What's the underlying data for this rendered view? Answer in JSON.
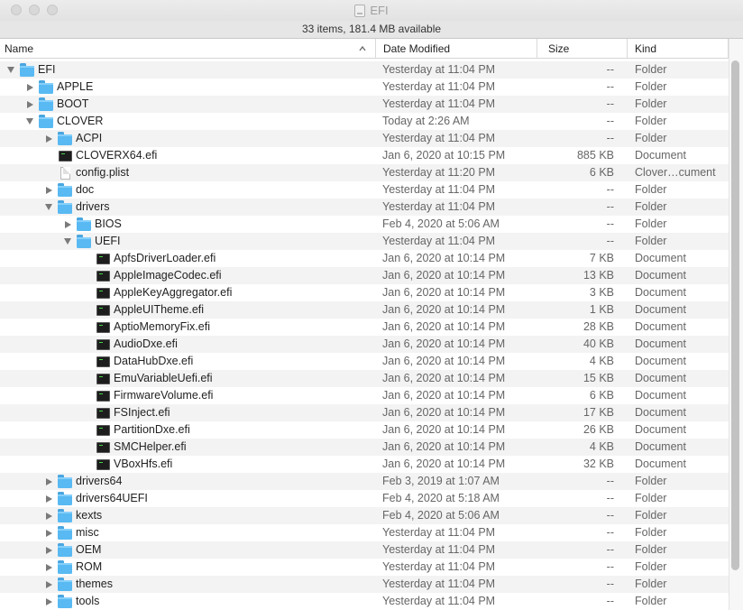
{
  "window": {
    "title": "EFI",
    "status": "33 items, 181.4 MB available"
  },
  "columns": {
    "name": "Name",
    "date": "Date Modified",
    "size": "Size",
    "kind": "Kind"
  },
  "icons": {
    "folder": "folder-icon",
    "executable": "executable-file-icon",
    "document": "document-file-icon"
  },
  "colors": {
    "folder": "#59b9f2",
    "row_alt": "#f3f3f3"
  },
  "rows": [
    {
      "name": "EFI",
      "date": "Yesterday at 11:04 PM",
      "size": "--",
      "kind": "Folder",
      "icon": "folder",
      "depth": 0,
      "expanded": true
    },
    {
      "name": "APPLE",
      "date": "Yesterday at 11:04 PM",
      "size": "--",
      "kind": "Folder",
      "icon": "folder",
      "depth": 1,
      "expanded": false
    },
    {
      "name": "BOOT",
      "date": "Yesterday at 11:04 PM",
      "size": "--",
      "kind": "Folder",
      "icon": "folder",
      "depth": 1,
      "expanded": false
    },
    {
      "name": "CLOVER",
      "date": "Today at 2:26 AM",
      "size": "--",
      "kind": "Folder",
      "icon": "folder",
      "depth": 1,
      "expanded": true
    },
    {
      "name": "ACPI",
      "date": "Yesterday at 11:04 PM",
      "size": "--",
      "kind": "Folder",
      "icon": "folder",
      "depth": 2,
      "expanded": false
    },
    {
      "name": "CLOVERX64.efi",
      "date": "Jan 6, 2020 at 10:15 PM",
      "size": "885 KB",
      "kind": "Document",
      "icon": "executable",
      "depth": 2
    },
    {
      "name": "config.plist",
      "date": "Yesterday at 11:20 PM",
      "size": "6 KB",
      "kind": "Clover…cument",
      "icon": "document",
      "depth": 2
    },
    {
      "name": "doc",
      "date": "Yesterday at 11:04 PM",
      "size": "--",
      "kind": "Folder",
      "icon": "folder",
      "depth": 2,
      "expanded": false
    },
    {
      "name": "drivers",
      "date": "Yesterday at 11:04 PM",
      "size": "--",
      "kind": "Folder",
      "icon": "folder",
      "depth": 2,
      "expanded": true
    },
    {
      "name": "BIOS",
      "date": "Feb 4, 2020 at 5:06 AM",
      "size": "--",
      "kind": "Folder",
      "icon": "folder",
      "depth": 3,
      "expanded": false
    },
    {
      "name": "UEFI",
      "date": "Yesterday at 11:04 PM",
      "size": "--",
      "kind": "Folder",
      "icon": "folder",
      "depth": 3,
      "expanded": true
    },
    {
      "name": "ApfsDriverLoader.efi",
      "date": "Jan 6, 2020 at 10:14 PM",
      "size": "7 KB",
      "kind": "Document",
      "icon": "executable",
      "depth": 4
    },
    {
      "name": "AppleImageCodec.efi",
      "date": "Jan 6, 2020 at 10:14 PM",
      "size": "13 KB",
      "kind": "Document",
      "icon": "executable",
      "depth": 4
    },
    {
      "name": "AppleKeyAggregator.efi",
      "date": "Jan 6, 2020 at 10:14 PM",
      "size": "3 KB",
      "kind": "Document",
      "icon": "executable",
      "depth": 4
    },
    {
      "name": "AppleUITheme.efi",
      "date": "Jan 6, 2020 at 10:14 PM",
      "size": "1 KB",
      "kind": "Document",
      "icon": "executable",
      "depth": 4
    },
    {
      "name": "AptioMemoryFix.efi",
      "date": "Jan 6, 2020 at 10:14 PM",
      "size": "28 KB",
      "kind": "Document",
      "icon": "executable",
      "depth": 4
    },
    {
      "name": "AudioDxe.efi",
      "date": "Jan 6, 2020 at 10:14 PM",
      "size": "40 KB",
      "kind": "Document",
      "icon": "executable",
      "depth": 4
    },
    {
      "name": "DataHubDxe.efi",
      "date": "Jan 6, 2020 at 10:14 PM",
      "size": "4 KB",
      "kind": "Document",
      "icon": "executable",
      "depth": 4
    },
    {
      "name": "EmuVariableUefi.efi",
      "date": "Jan 6, 2020 at 10:14 PM",
      "size": "15 KB",
      "kind": "Document",
      "icon": "executable",
      "depth": 4
    },
    {
      "name": "FirmwareVolume.efi",
      "date": "Jan 6, 2020 at 10:14 PM",
      "size": "6 KB",
      "kind": "Document",
      "icon": "executable",
      "depth": 4
    },
    {
      "name": "FSInject.efi",
      "date": "Jan 6, 2020 at 10:14 PM",
      "size": "17 KB",
      "kind": "Document",
      "icon": "executable",
      "depth": 4
    },
    {
      "name": "PartitionDxe.efi",
      "date": "Jan 6, 2020 at 10:14 PM",
      "size": "26 KB",
      "kind": "Document",
      "icon": "executable",
      "depth": 4
    },
    {
      "name": "SMCHelper.efi",
      "date": "Jan 6, 2020 at 10:14 PM",
      "size": "4 KB",
      "kind": "Document",
      "icon": "executable",
      "depth": 4
    },
    {
      "name": "VBoxHfs.efi",
      "date": "Jan 6, 2020 at 10:14 PM",
      "size": "32 KB",
      "kind": "Document",
      "icon": "executable",
      "depth": 4
    },
    {
      "name": "drivers64",
      "date": "Feb 3, 2019 at 1:07 AM",
      "size": "--",
      "kind": "Folder",
      "icon": "folder",
      "depth": 2,
      "expanded": false
    },
    {
      "name": "drivers64UEFI",
      "date": "Feb 4, 2020 at 5:18 AM",
      "size": "--",
      "kind": "Folder",
      "icon": "folder",
      "depth": 2,
      "expanded": false
    },
    {
      "name": "kexts",
      "date": "Feb 4, 2020 at 5:06 AM",
      "size": "--",
      "kind": "Folder",
      "icon": "folder",
      "depth": 2,
      "expanded": false
    },
    {
      "name": "misc",
      "date": "Yesterday at 11:04 PM",
      "size": "--",
      "kind": "Folder",
      "icon": "folder",
      "depth": 2,
      "expanded": false
    },
    {
      "name": "OEM",
      "date": "Yesterday at 11:04 PM",
      "size": "--",
      "kind": "Folder",
      "icon": "folder",
      "depth": 2,
      "expanded": false
    },
    {
      "name": "ROM",
      "date": "Yesterday at 11:04 PM",
      "size": "--",
      "kind": "Folder",
      "icon": "folder",
      "depth": 2,
      "expanded": false
    },
    {
      "name": "themes",
      "date": "Yesterday at 11:04 PM",
      "size": "--",
      "kind": "Folder",
      "icon": "folder",
      "depth": 2,
      "expanded": false
    },
    {
      "name": "tools",
      "date": "Yesterday at 11:04 PM",
      "size": "--",
      "kind": "Folder",
      "icon": "folder",
      "depth": 2,
      "expanded": false
    }
  ]
}
